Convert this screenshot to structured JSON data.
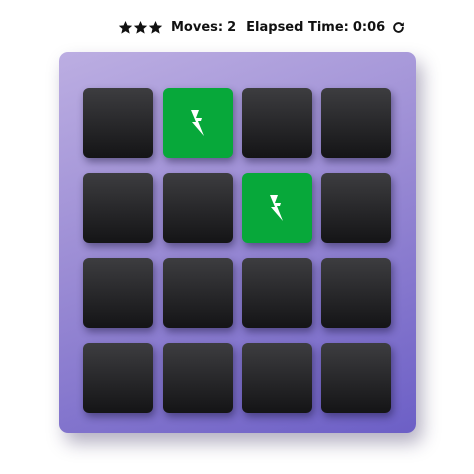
{
  "score_panel": {
    "stars": [
      "star-icon",
      "star-icon",
      "star-icon"
    ],
    "moves_label": "Moves:",
    "moves_value": "2",
    "time_label": "Elapsed Time:",
    "time_value": "0:06",
    "restart_icon": "restart-icon"
  },
  "colors": {
    "card_back": "#1f1f22",
    "card_matched": "#07a83a",
    "deck_gradient_start": "#bcaee2",
    "deck_gradient_end": "#6c5fc6"
  },
  "cards": [
    {
      "state": "hidden",
      "icon": ""
    },
    {
      "state": "matched",
      "icon": "bolt-icon"
    },
    {
      "state": "hidden",
      "icon": ""
    },
    {
      "state": "hidden",
      "icon": ""
    },
    {
      "state": "hidden",
      "icon": ""
    },
    {
      "state": "hidden",
      "icon": ""
    },
    {
      "state": "matched",
      "icon": "bolt-icon"
    },
    {
      "state": "hidden",
      "icon": ""
    },
    {
      "state": "hidden",
      "icon": ""
    },
    {
      "state": "hidden",
      "icon": ""
    },
    {
      "state": "hidden",
      "icon": ""
    },
    {
      "state": "hidden",
      "icon": ""
    },
    {
      "state": "hidden",
      "icon": ""
    },
    {
      "state": "hidden",
      "icon": ""
    },
    {
      "state": "hidden",
      "icon": ""
    },
    {
      "state": "hidden",
      "icon": ""
    }
  ]
}
